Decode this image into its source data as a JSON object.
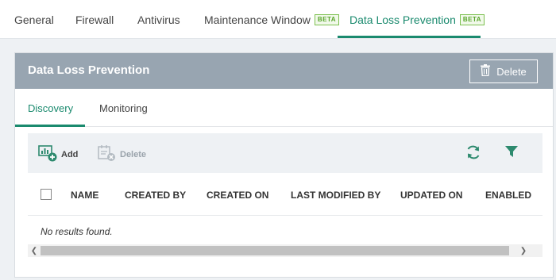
{
  "top_tabs": [
    {
      "label": "General"
    },
    {
      "label": "Firewall"
    },
    {
      "label": "Antivirus"
    },
    {
      "label": "Maintenance Window",
      "badge": "BETA"
    },
    {
      "label": "Data Loss Prevention",
      "badge": "BETA",
      "active": true
    }
  ],
  "panel": {
    "title": "Data Loss Prevention",
    "delete_label": "Delete"
  },
  "sub_tabs": [
    {
      "label": "Discovery",
      "active": true
    },
    {
      "label": "Monitoring"
    }
  ],
  "toolbar": {
    "add_label": "Add",
    "delete_label": "Delete",
    "icons": [
      "add-policy-icon",
      "delete-policy-icon",
      "refresh-icon",
      "filter-icon"
    ]
  },
  "table": {
    "columns": [
      "NAME",
      "CREATED BY",
      "CREATED ON",
      "LAST MODIFIED BY",
      "UPDATED ON",
      "ENABLED"
    ],
    "empty_message": "No results found."
  },
  "colors": {
    "accent": "#1a8a6e",
    "header_bg": "#98a5b1",
    "badge": "#58a52b"
  }
}
